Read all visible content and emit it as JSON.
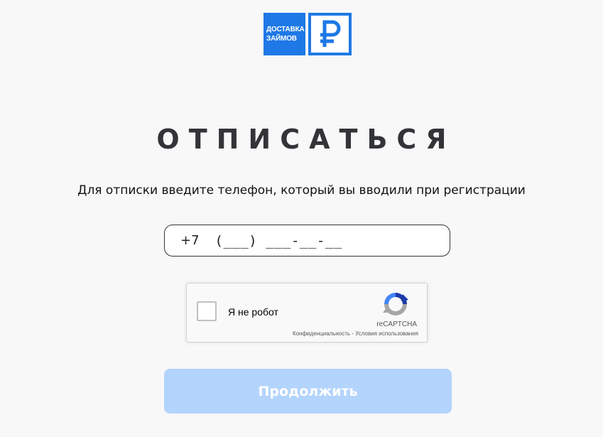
{
  "logo": {
    "line1": "ДОСТАВКА",
    "line2": "ЗАЙМОВ",
    "mark_icon": "ruble-sign-icon",
    "brand_color": "#1e78e6"
  },
  "title": "ОТПИСАТЬСЯ",
  "subtitle": "Для отписки введите телефон, который вы вводили при регистрации",
  "phone": {
    "prefix": "+7",
    "mask": "(___) ___-__-__"
  },
  "captcha": {
    "checkbox_label": "Я не робот",
    "brand": "reCAPTCHA",
    "privacy_link": "Конфиденциальность",
    "separator": " - ",
    "terms_link": "Условия использования",
    "icon": "recaptcha-icon"
  },
  "continue_button": {
    "label": "Продолжить",
    "color": "#b3d4fc"
  }
}
